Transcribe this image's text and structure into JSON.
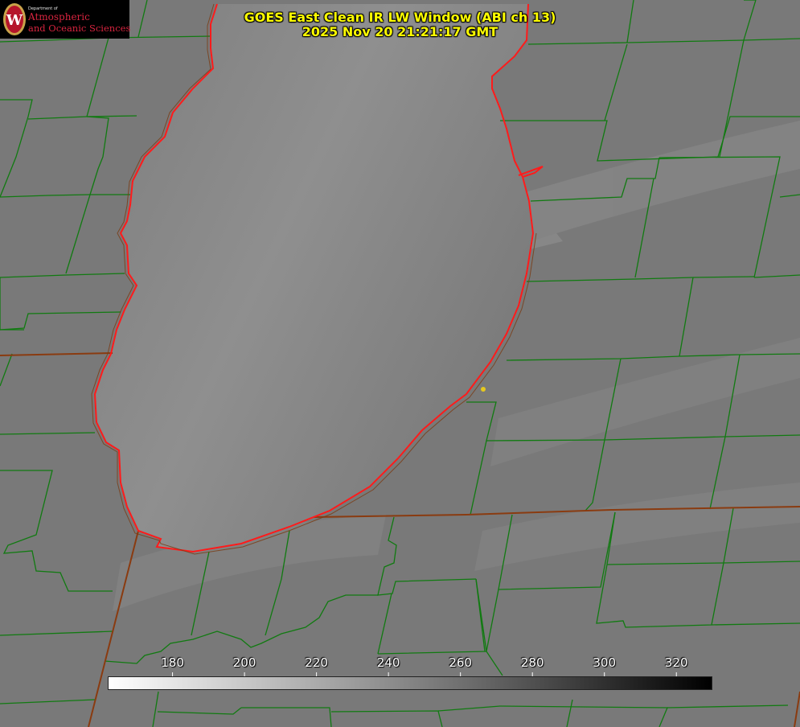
{
  "title": {
    "line1": "GOES East Clean IR LW Window (ABI ch 13)",
    "line2": "2025 Nov 20 21:21:17 GMT"
  },
  "logo": {
    "dept": "Department of",
    "line1": "Atmospheric",
    "line2": "and Oceanic Sciences",
    "mark_letter": "W",
    "mark_icon": "uw-crest-icon"
  },
  "colorbar": {
    "range_min": 162,
    "range_max": 330,
    "ticks": [
      "180",
      "200",
      "220",
      "240",
      "260",
      "280",
      "300",
      "320"
    ],
    "tick_values": [
      180,
      200,
      220,
      240,
      260,
      280,
      300,
      320
    ]
  },
  "colors": {
    "county_lines": "#117a11",
    "state_lines": "#8a3b10",
    "shoreline": "#ff1b1b",
    "title_text": "#ffff00",
    "marker": "#e6c81e"
  }
}
